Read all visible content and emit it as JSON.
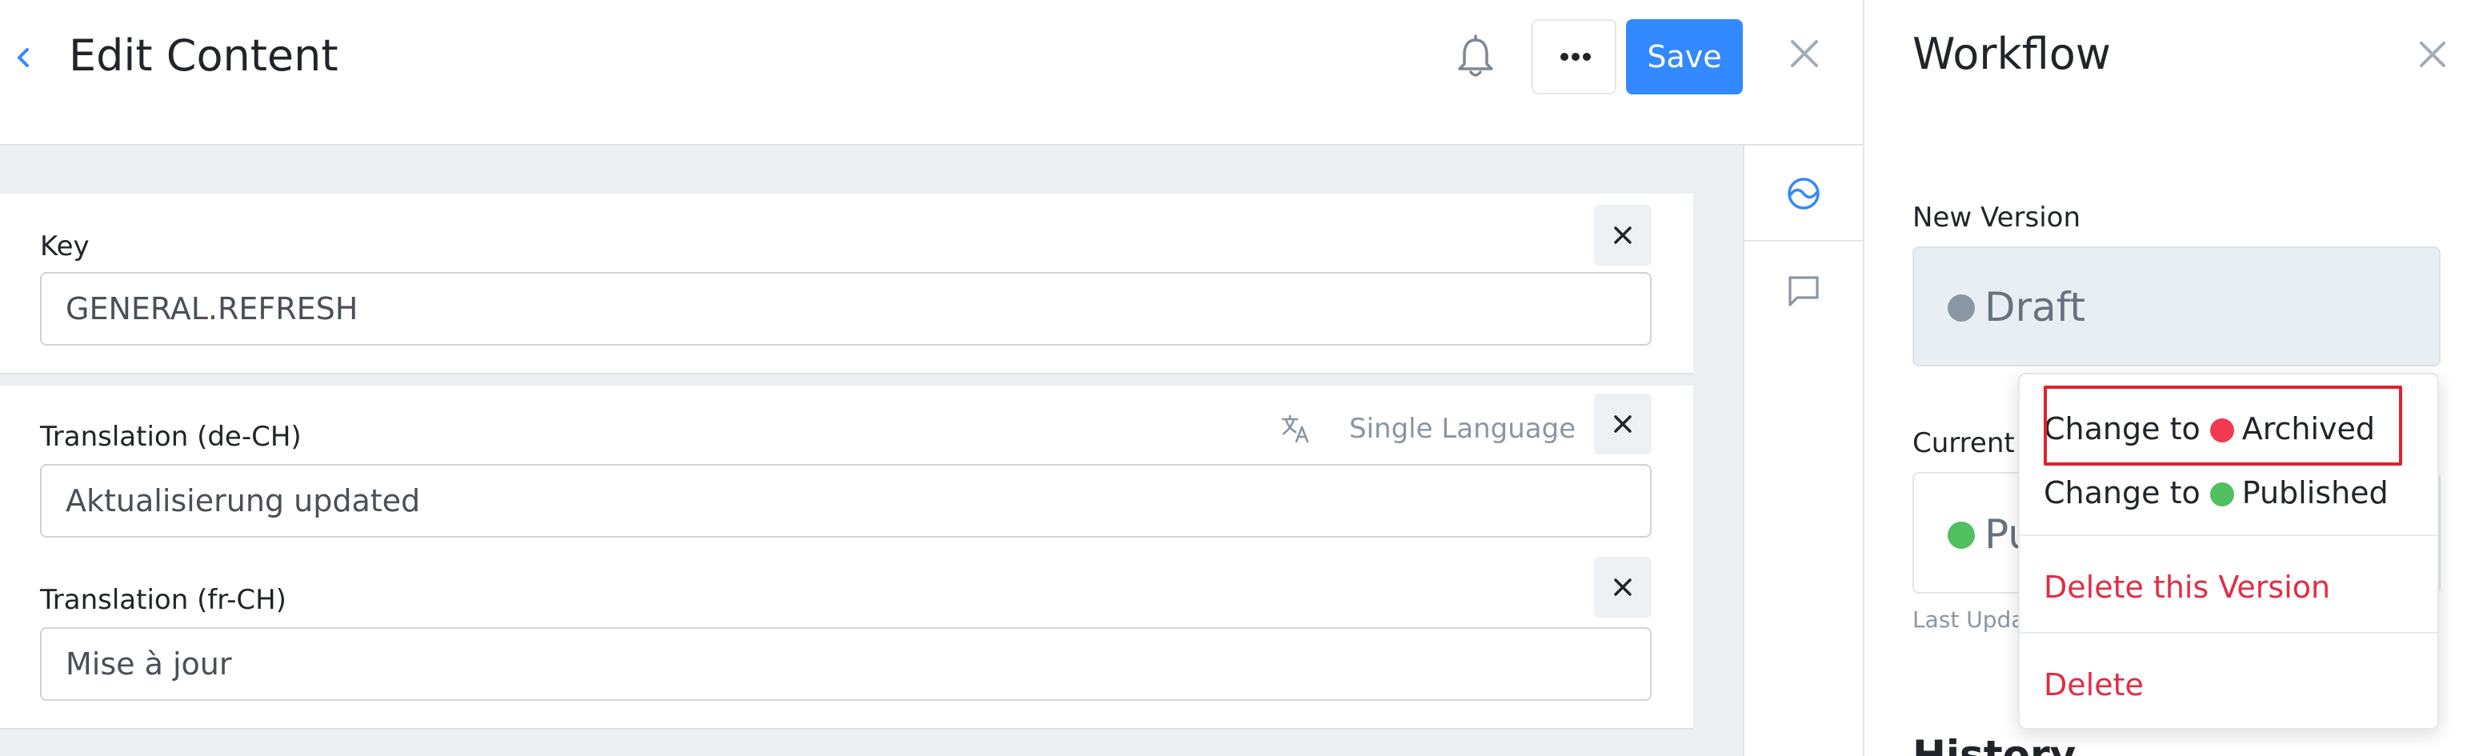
{
  "header": {
    "back_icon": "chevron-left-icon",
    "title": "Edit Content",
    "notification_icon": "bell-icon",
    "more_icon": "more-horizontal-icon",
    "save_label": "Save",
    "close_icon": "close-icon"
  },
  "content": {
    "fields": [
      {
        "label": "Key",
        "value": "GENERAL.REFRESH"
      },
      {
        "label": "Translation (de-CH)",
        "value": "Aktualisierung updated"
      },
      {
        "label": "Translation (fr-CH)",
        "value": "Mise à jour"
      }
    ],
    "language_toggle": {
      "icon": "translate-icon",
      "label": "Single Language"
    }
  },
  "side_rail": {
    "items": [
      {
        "icon": "workflow-icon",
        "active": true
      },
      {
        "icon": "comment-icon",
        "active": false
      }
    ]
  },
  "workflow": {
    "title": "Workflow",
    "new_version_label": "New Version",
    "new_version_status": "Draft",
    "current_label": "Current",
    "current_status": "Pu",
    "last_updated_text": "Last Upda",
    "history_title": "History"
  },
  "dropdown": {
    "change_to_archived": {
      "prefix": "Change to",
      "status": "Archived"
    },
    "change_to_published": {
      "prefix": "Change to",
      "status": "Published"
    },
    "delete_version": "Delete this Version",
    "delete": "Delete"
  },
  "colors": {
    "accent": "#3389ff",
    "draft": "#8a96a3",
    "archived": "#f03a4f",
    "published": "#4fbf5f",
    "danger": "#e12d44",
    "highlight": "#e0222e"
  }
}
